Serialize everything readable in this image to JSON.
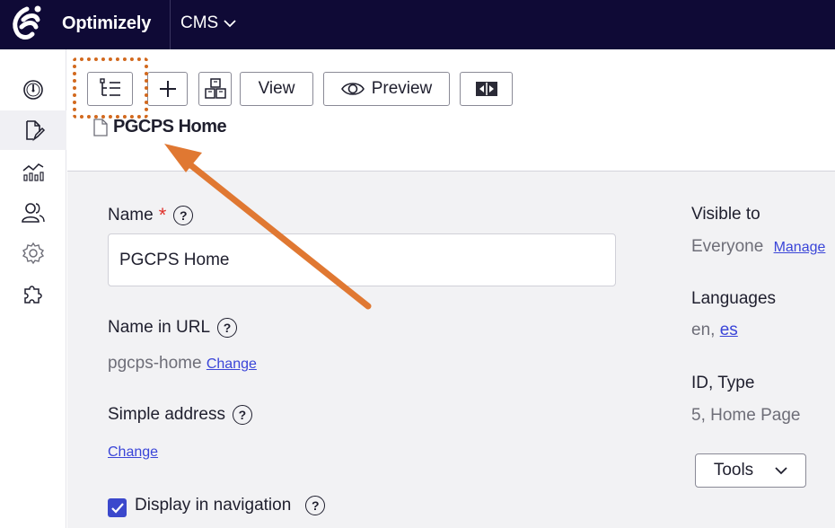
{
  "topbar": {
    "brand": "Optimizely",
    "product": "CMS"
  },
  "nav": {
    "items": [
      {
        "icon": "dashboard-icon"
      },
      {
        "icon": "edit-icon"
      },
      {
        "icon": "analytics-icon"
      },
      {
        "icon": "users-icon"
      },
      {
        "icon": "settings-icon"
      },
      {
        "icon": "addons-icon"
      }
    ]
  },
  "toolbar": {
    "view_label": "View",
    "preview_label": "Preview"
  },
  "page": {
    "title": "PGCPS Home"
  },
  "form": {
    "name_label": "Name",
    "name_required": "*",
    "name_value": "PGCPS Home",
    "url_label": "Name in URL",
    "url_value": "pgcps-home",
    "url_change": "Change",
    "simple_label": "Simple address",
    "simple_change": "Change",
    "display_nav_label": "Display in navigation",
    "help_glyph": "?"
  },
  "sidebar": {
    "visible_label": "Visible to",
    "visible_value": "Everyone",
    "manage_link": "Manage",
    "languages_label": "Languages",
    "lang_en": "en,",
    "lang_es": "es",
    "id_label": "ID, Type",
    "id_value": "5, Home Page",
    "tools_label": "Tools"
  },
  "colors": {
    "topbar": "#0f0a36",
    "accent": "#3b48cc",
    "annotation": "#e07832"
  }
}
